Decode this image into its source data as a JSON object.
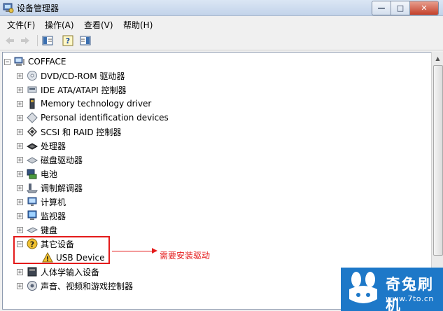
{
  "window": {
    "title": "设备管理器",
    "minimize": "—",
    "maximize": "□",
    "close": "✕"
  },
  "menu": [
    "文件(F)",
    "操作(A)",
    "查看(V)",
    "帮助(H)"
  ],
  "tree": {
    "root": "COFFACE",
    "items": [
      {
        "label": "DVD/CD-ROM 驱动器",
        "icon": "dvd-drive-icon",
        "expander": "+"
      },
      {
        "label": "IDE ATA/ATAPI 控制器",
        "icon": "ide-controller-icon",
        "expander": "+"
      },
      {
        "label": "Memory technology driver",
        "icon": "memory-icon",
        "expander": "+"
      },
      {
        "label": "Personal identification devices",
        "icon": "id-device-icon",
        "expander": "+"
      },
      {
        "label": "SCSI 和 RAID 控制器",
        "icon": "scsi-icon",
        "expander": "+"
      },
      {
        "label": "处理器",
        "icon": "processor-icon",
        "expander": "+"
      },
      {
        "label": "磁盘驱动器",
        "icon": "disk-drive-icon",
        "expander": "+"
      },
      {
        "label": "电池",
        "icon": "battery-icon",
        "expander": "+"
      },
      {
        "label": "调制解调器",
        "icon": "modem-icon",
        "expander": "+"
      },
      {
        "label": "计算机",
        "icon": "computer-icon",
        "expander": "+"
      },
      {
        "label": "监视器",
        "icon": "monitor-icon",
        "expander": "+"
      },
      {
        "label": "键盘",
        "icon": "keyboard-icon",
        "expander": "+"
      },
      {
        "label": "其它设备",
        "icon": "unknown-device-icon",
        "expander": "−"
      },
      {
        "label": "USB Device",
        "icon": "warning-device-icon",
        "expander": ""
      },
      {
        "label": "人体学输入设备",
        "icon": "hid-icon",
        "expander": "+"
      },
      {
        "label": "声音、视频和游戏控制器",
        "icon": "sound-icon",
        "expander": "+"
      }
    ]
  },
  "annotation": "需要安装驱动",
  "watermark": {
    "name": "奇兔刷机",
    "url": "www.7to.cn"
  },
  "colors": {
    "highlight": "#e41b1b",
    "logo_bg": "#1d78c8"
  }
}
